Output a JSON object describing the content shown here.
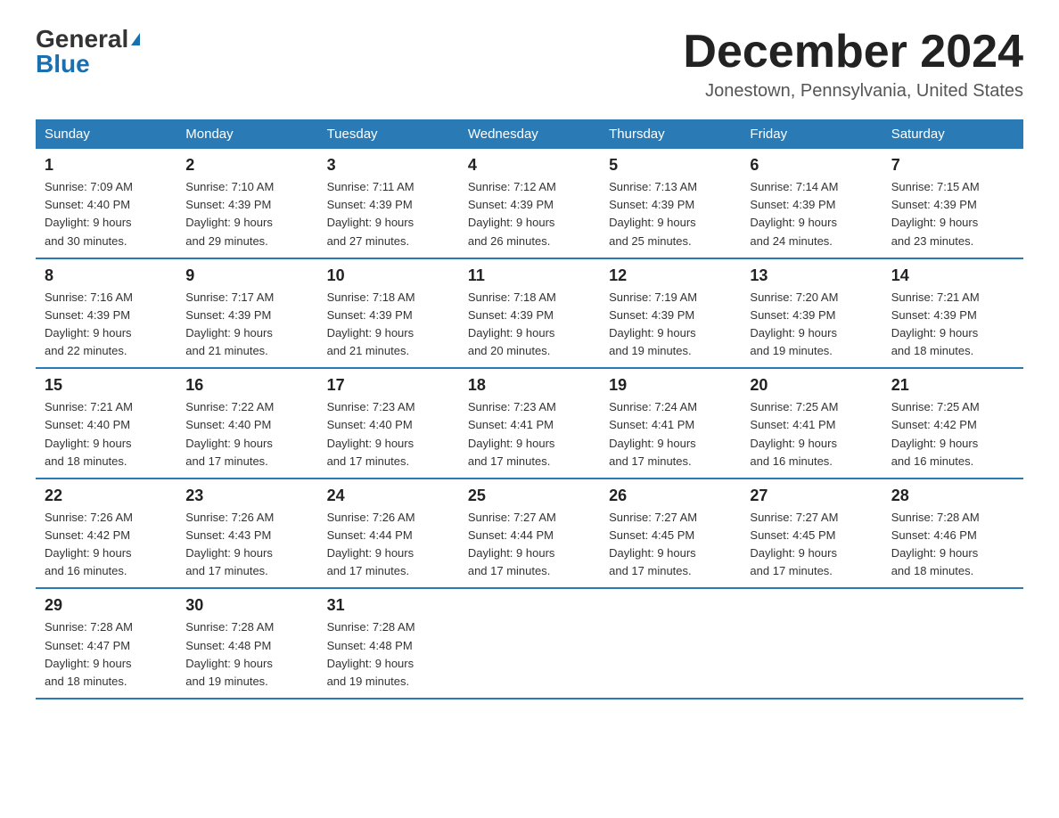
{
  "logo": {
    "general": "General",
    "blue": "Blue"
  },
  "header": {
    "month": "December 2024",
    "location": "Jonestown, Pennsylvania, United States"
  },
  "weekdays": [
    "Sunday",
    "Monday",
    "Tuesday",
    "Wednesday",
    "Thursday",
    "Friday",
    "Saturday"
  ],
  "weeks": [
    [
      {
        "day": "1",
        "sunrise": "7:09 AM",
        "sunset": "4:40 PM",
        "daylight": "9 hours and 30 minutes."
      },
      {
        "day": "2",
        "sunrise": "7:10 AM",
        "sunset": "4:39 PM",
        "daylight": "9 hours and 29 minutes."
      },
      {
        "day": "3",
        "sunrise": "7:11 AM",
        "sunset": "4:39 PM",
        "daylight": "9 hours and 27 minutes."
      },
      {
        "day": "4",
        "sunrise": "7:12 AM",
        "sunset": "4:39 PM",
        "daylight": "9 hours and 26 minutes."
      },
      {
        "day": "5",
        "sunrise": "7:13 AM",
        "sunset": "4:39 PM",
        "daylight": "9 hours and 25 minutes."
      },
      {
        "day": "6",
        "sunrise": "7:14 AM",
        "sunset": "4:39 PM",
        "daylight": "9 hours and 24 minutes."
      },
      {
        "day": "7",
        "sunrise": "7:15 AM",
        "sunset": "4:39 PM",
        "daylight": "9 hours and 23 minutes."
      }
    ],
    [
      {
        "day": "8",
        "sunrise": "7:16 AM",
        "sunset": "4:39 PM",
        "daylight": "9 hours and 22 minutes."
      },
      {
        "day": "9",
        "sunrise": "7:17 AM",
        "sunset": "4:39 PM",
        "daylight": "9 hours and 21 minutes."
      },
      {
        "day": "10",
        "sunrise": "7:18 AM",
        "sunset": "4:39 PM",
        "daylight": "9 hours and 21 minutes."
      },
      {
        "day": "11",
        "sunrise": "7:18 AM",
        "sunset": "4:39 PM",
        "daylight": "9 hours and 20 minutes."
      },
      {
        "day": "12",
        "sunrise": "7:19 AM",
        "sunset": "4:39 PM",
        "daylight": "9 hours and 19 minutes."
      },
      {
        "day": "13",
        "sunrise": "7:20 AM",
        "sunset": "4:39 PM",
        "daylight": "9 hours and 19 minutes."
      },
      {
        "day": "14",
        "sunrise": "7:21 AM",
        "sunset": "4:39 PM",
        "daylight": "9 hours and 18 minutes."
      }
    ],
    [
      {
        "day": "15",
        "sunrise": "7:21 AM",
        "sunset": "4:40 PM",
        "daylight": "9 hours and 18 minutes."
      },
      {
        "day": "16",
        "sunrise": "7:22 AM",
        "sunset": "4:40 PM",
        "daylight": "9 hours and 17 minutes."
      },
      {
        "day": "17",
        "sunrise": "7:23 AM",
        "sunset": "4:40 PM",
        "daylight": "9 hours and 17 minutes."
      },
      {
        "day": "18",
        "sunrise": "7:23 AM",
        "sunset": "4:41 PM",
        "daylight": "9 hours and 17 minutes."
      },
      {
        "day": "19",
        "sunrise": "7:24 AM",
        "sunset": "4:41 PM",
        "daylight": "9 hours and 17 minutes."
      },
      {
        "day": "20",
        "sunrise": "7:25 AM",
        "sunset": "4:41 PM",
        "daylight": "9 hours and 16 minutes."
      },
      {
        "day": "21",
        "sunrise": "7:25 AM",
        "sunset": "4:42 PM",
        "daylight": "9 hours and 16 minutes."
      }
    ],
    [
      {
        "day": "22",
        "sunrise": "7:26 AM",
        "sunset": "4:42 PM",
        "daylight": "9 hours and 16 minutes."
      },
      {
        "day": "23",
        "sunrise": "7:26 AM",
        "sunset": "4:43 PM",
        "daylight": "9 hours and 17 minutes."
      },
      {
        "day": "24",
        "sunrise": "7:26 AM",
        "sunset": "4:44 PM",
        "daylight": "9 hours and 17 minutes."
      },
      {
        "day": "25",
        "sunrise": "7:27 AM",
        "sunset": "4:44 PM",
        "daylight": "9 hours and 17 minutes."
      },
      {
        "day": "26",
        "sunrise": "7:27 AM",
        "sunset": "4:45 PM",
        "daylight": "9 hours and 17 minutes."
      },
      {
        "day": "27",
        "sunrise": "7:27 AM",
        "sunset": "4:45 PM",
        "daylight": "9 hours and 17 minutes."
      },
      {
        "day": "28",
        "sunrise": "7:28 AM",
        "sunset": "4:46 PM",
        "daylight": "9 hours and 18 minutes."
      }
    ],
    [
      {
        "day": "29",
        "sunrise": "7:28 AM",
        "sunset": "4:47 PM",
        "daylight": "9 hours and 18 minutes."
      },
      {
        "day": "30",
        "sunrise": "7:28 AM",
        "sunset": "4:48 PM",
        "daylight": "9 hours and 19 minutes."
      },
      {
        "day": "31",
        "sunrise": "7:28 AM",
        "sunset": "4:48 PM",
        "daylight": "9 hours and 19 minutes."
      },
      null,
      null,
      null,
      null
    ]
  ],
  "labels": {
    "sunrise": "Sunrise:",
    "sunset": "Sunset:",
    "daylight": "Daylight:"
  }
}
